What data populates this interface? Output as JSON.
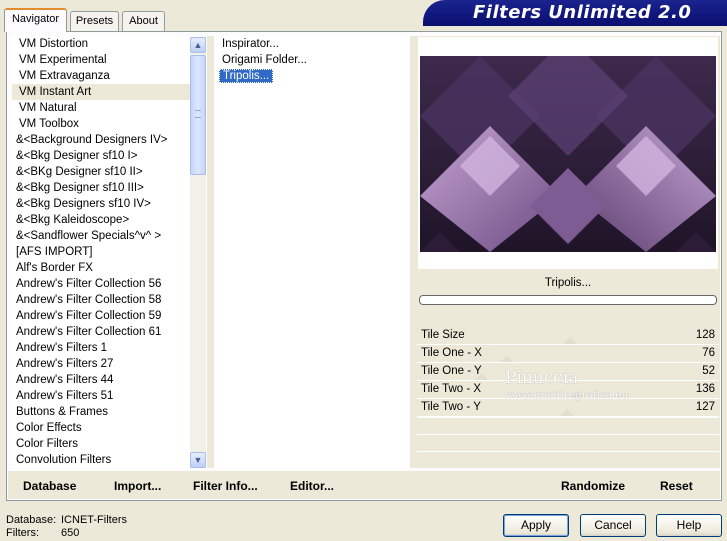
{
  "tabs": [
    {
      "label": "Navigator",
      "active": true
    },
    {
      "label": "Presets",
      "active": false
    },
    {
      "label": "About",
      "active": false
    }
  ],
  "app_title": "Filters Unlimited 2.0",
  "categories": [
    {
      "label": "VM Distortion"
    },
    {
      "label": "VM Experimental"
    },
    {
      "label": "VM Extravaganza"
    },
    {
      "label": "VM Instant Art",
      "selected": true
    },
    {
      "label": "VM Natural"
    },
    {
      "label": "VM Toolbox"
    },
    {
      "label": "&<Background Designers IV>"
    },
    {
      "label": "&<Bkg Designer sf10 I>"
    },
    {
      "label": "&<BKg Designer sf10 II>"
    },
    {
      "label": "&<Bkg Designer sf10 III>"
    },
    {
      "label": "&<Bkg Designers sf10 IV>"
    },
    {
      "label": "&<Bkg Kaleidoscope>"
    },
    {
      "label": "&<Sandflower Specials^v^ >"
    },
    {
      "label": "[AFS IMPORT]"
    },
    {
      "label": "Alf's Border FX"
    },
    {
      "label": "Andrew's Filter Collection 56"
    },
    {
      "label": "Andrew's Filter Collection 58"
    },
    {
      "label": "Andrew's Filter Collection 59"
    },
    {
      "label": "Andrew's Filter Collection 61"
    },
    {
      "label": "Andrew's Filters 1"
    },
    {
      "label": "Andrew's Filters 27"
    },
    {
      "label": "Andrew's Filters 44"
    },
    {
      "label": "Andrew's Filters 51"
    },
    {
      "label": "Buttons & Frames"
    },
    {
      "label": "Color Effects"
    },
    {
      "label": "Color Filters"
    },
    {
      "label": "Convolution Filters"
    }
  ],
  "filters": [
    {
      "label": "Inspirator..."
    },
    {
      "label": "Origami Folder..."
    },
    {
      "label": "Tripolis...",
      "selected": true
    }
  ],
  "preview": {
    "filter_name": "Tripolis..."
  },
  "params": [
    {
      "label": "Tile Size",
      "value": "128"
    },
    {
      "label": "Tile One - X",
      "value": "76"
    },
    {
      "label": "Tile One - Y",
      "value": "52"
    },
    {
      "label": "Tile Two - X",
      "value": "136"
    },
    {
      "label": "Tile Two - Y",
      "value": "127"
    }
  ],
  "watermark": {
    "name": "Pinuccia",
    "site": "www.maidiregrafica.eu"
  },
  "bottom_buttons": {
    "database": "Database",
    "import": "Import...",
    "filter_info": "Filter Info...",
    "editor": "Editor...",
    "randomize": "Randomize",
    "reset": "Reset"
  },
  "status": {
    "database_label": "Database:",
    "database_value": "ICNET-Filters",
    "filters_label": "Filters:",
    "filters_value": "650"
  },
  "dialog_buttons": {
    "apply": "Apply",
    "cancel": "Cancel",
    "help": "Help"
  },
  "colors": {
    "accent": "#316ac5",
    "title_bar": "#0a0f6f",
    "preview_purple": "#a883b8"
  }
}
